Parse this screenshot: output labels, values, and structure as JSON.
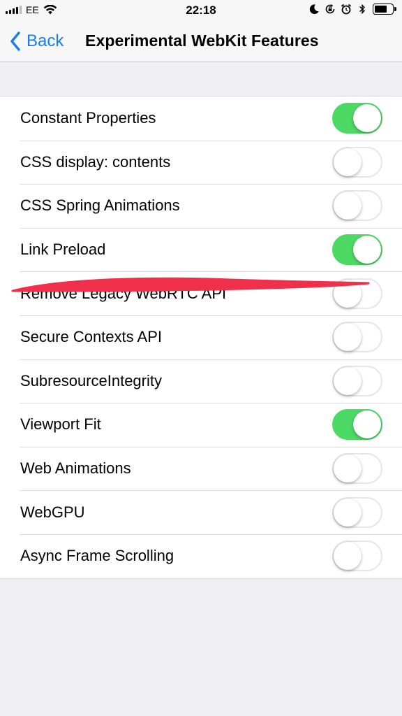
{
  "status_bar": {
    "carrier": "EE",
    "time": "22:18",
    "battery_level": 0.7,
    "icons": [
      "signal-icon",
      "wifi-icon",
      "moon-icon",
      "orientation-lock-icon",
      "alarm-icon",
      "bluetooth-icon",
      "battery-icon"
    ]
  },
  "nav": {
    "back_label": "Back",
    "title": "Experimental WebKit Features"
  },
  "features": [
    {
      "label": "Constant Properties",
      "enabled": true
    },
    {
      "label": "CSS display: contents",
      "enabled": false
    },
    {
      "label": "CSS Spring Animations",
      "enabled": false
    },
    {
      "label": "Link Preload",
      "enabled": true
    },
    {
      "label": "Remove Legacy WebRTC API",
      "enabled": false
    },
    {
      "label": "Secure Contexts API",
      "enabled": false
    },
    {
      "label": "SubresourceIntegrity",
      "enabled": false
    },
    {
      "label": "Viewport Fit",
      "enabled": true
    },
    {
      "label": "Web Animations",
      "enabled": false
    },
    {
      "label": "WebGPU",
      "enabled": false
    },
    {
      "label": "Async Frame Scrolling",
      "enabled": false
    }
  ],
  "colors": {
    "accent": "#1a7cf2",
    "toggle_on": "#4cd964",
    "background": "#efeff4",
    "annotation": "#f0304a"
  }
}
